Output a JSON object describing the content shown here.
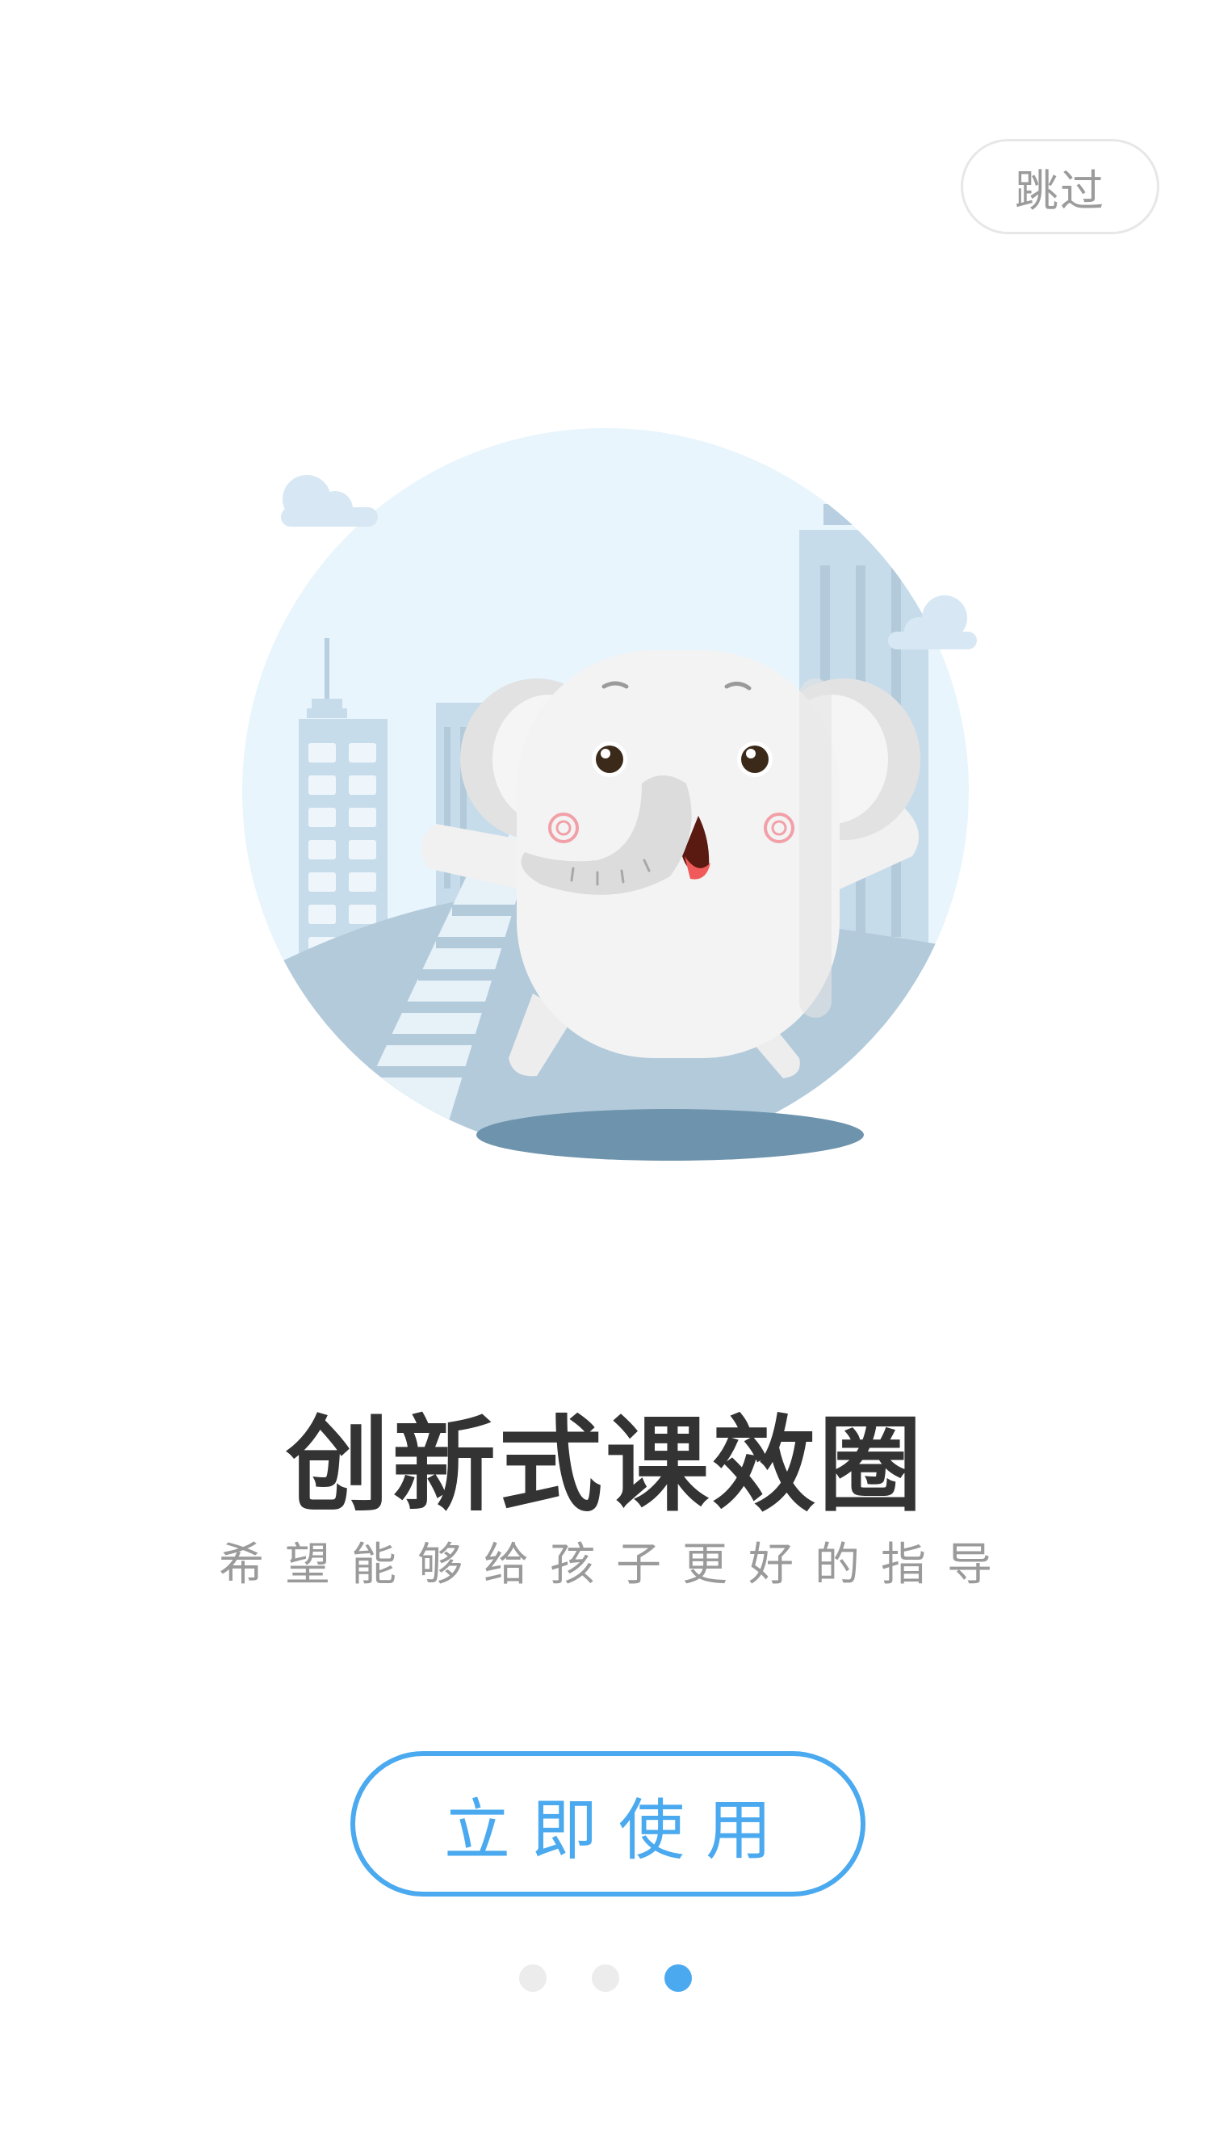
{
  "header": {
    "skip_label": "跳过"
  },
  "illustration": {
    "icon": "elephant-city-illustration",
    "colors": {
      "sky": "#e8f5fd",
      "building": "#c7dcea",
      "hill": "#b3cadb",
      "shadow": "#6e94ad",
      "elephant": "#f1f1f1"
    }
  },
  "main": {
    "title": "创新式课效圈",
    "subtitle": "希望能够给孩子更好的指导",
    "start_button_label": "立即使用"
  },
  "pagination": {
    "total": 3,
    "active_index": 2
  },
  "colors": {
    "accent": "#4aa9ef",
    "title": "#333333",
    "subtitle": "#9a9a9a",
    "inactive_dot": "#ececec"
  }
}
